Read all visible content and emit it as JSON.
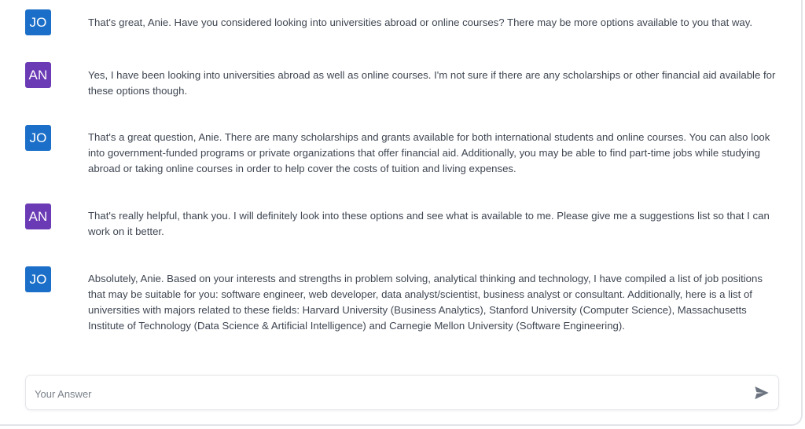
{
  "messages": [
    {
      "author": "JO",
      "text": "That's great, Anie. Have you considered looking into universities abroad or online courses? There may be more options available to you that way."
    },
    {
      "author": "AN",
      "text": "Yes, I have been looking into universities abroad as well as online courses. I'm not sure if there are any scholarships or other financial aid available for these options though."
    },
    {
      "author": "JO",
      "text": "That's a great question, Anie. There are many scholarships and grants available for both international students and online courses. You can also look into government-funded programs or private organizations that offer financial aid. Additionally, you may be able to find part-time jobs while studying abroad or taking online courses in order to help cover the costs of tuition and living expenses."
    },
    {
      "author": "AN",
      "text": "That's really helpful, thank you. I will definitely look into these options and see what is available to me. Please give me a suggestions list so that I can work on it better."
    },
    {
      "author": "JO",
      "text": "Absolutely, Anie. Based on your interests and strengths in problem solving, analytical thinking and technology, I have compiled a list of job positions that may be suitable for you: software engineer, web developer, data analyst/scientist, business analyst or consultant. Additionally, here is a list of universities with majors related to these fields: Harvard University (Business Analytics), Stanford University (Computer Science), Massachusetts Institute of Technology (Data Science & Artificial Intelligence) and Carnegie Mellon University (Software Engineering)."
    }
  ],
  "composer": {
    "placeholder": "Your Answer",
    "value": "",
    "send_icon": "send-icon"
  },
  "colors": {
    "jo_avatar": "#1c6fc8",
    "an_avatar": "#6b3bb5",
    "text": "#3f4652",
    "send_icon": "#6b7380"
  }
}
